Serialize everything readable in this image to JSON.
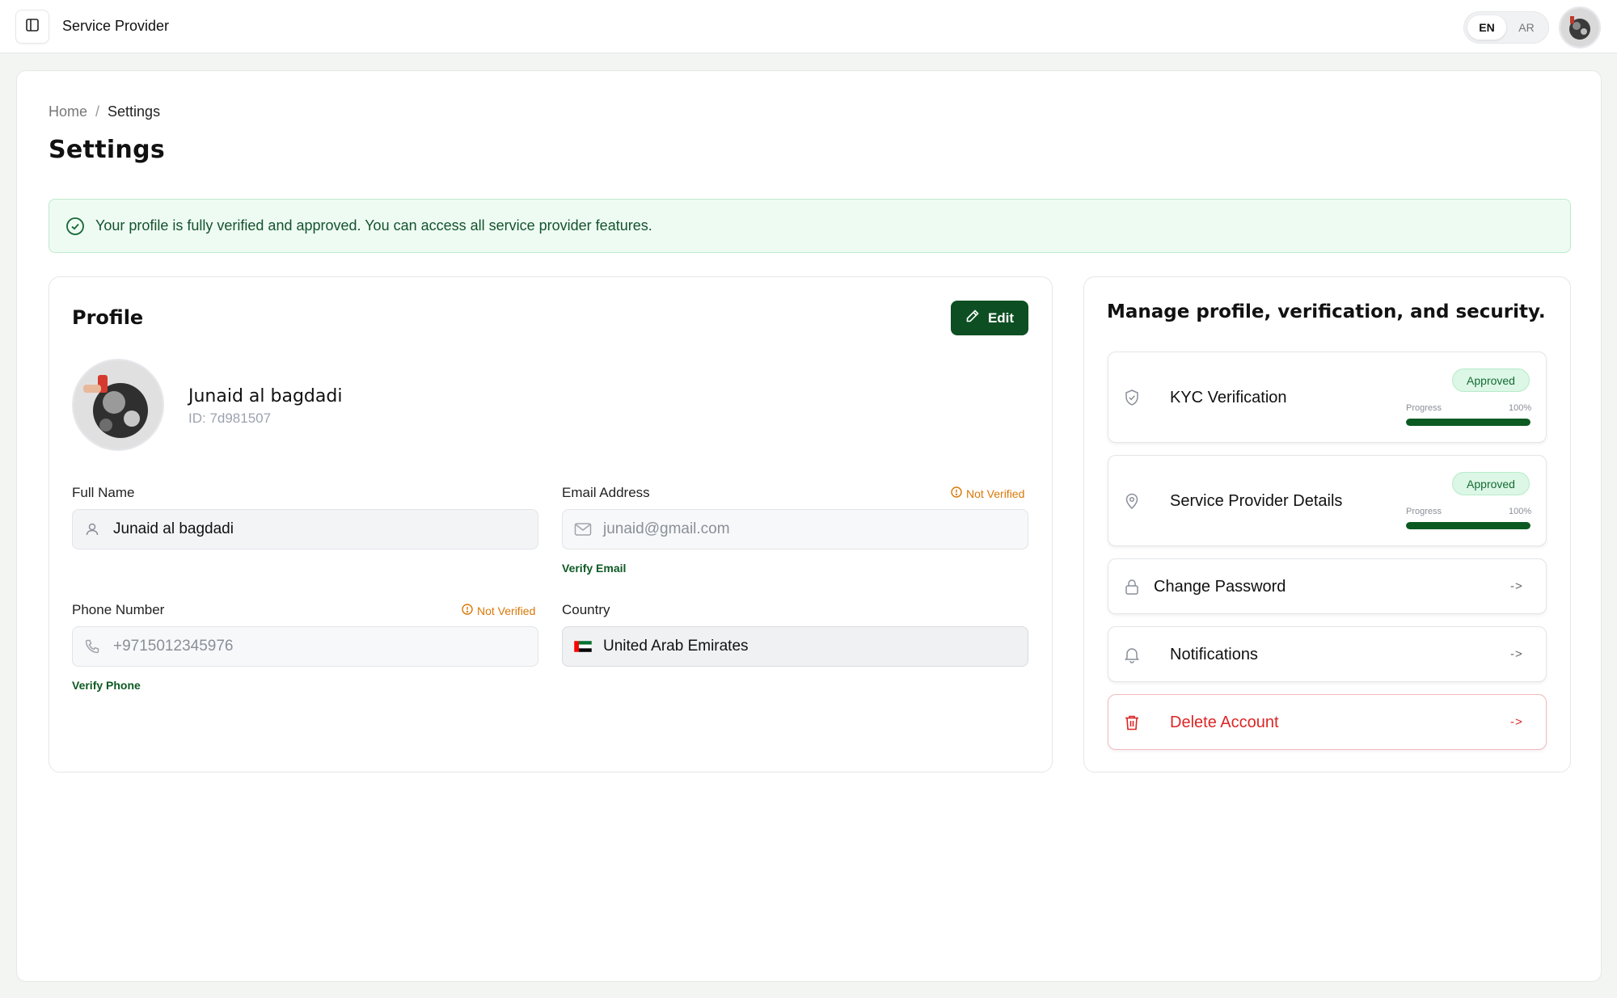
{
  "app": {
    "title": "Service Provider"
  },
  "language": {
    "en": "EN",
    "ar": "AR",
    "selected": "EN"
  },
  "breadcrumb": {
    "home": "Home",
    "separator": "/",
    "current": "Settings"
  },
  "page": {
    "title": "Settings"
  },
  "alert": {
    "message": "Your profile is fully verified and approved. You can access all service provider features."
  },
  "profile": {
    "title": "Profile",
    "edit_label": "Edit",
    "name": "Junaid al bagdadi",
    "id": "ID: 7d981507",
    "fields": {
      "full_name": {
        "label": "Full Name",
        "value": "Junaid al bagdadi"
      },
      "email": {
        "label": "Email Address",
        "value": "junaid@gmail.com",
        "status": "Not Verified",
        "action": "Verify Email"
      },
      "phone": {
        "label": "Phone Number",
        "value": "+9715012345976",
        "status": "Not Verified",
        "action": "Verify Phone"
      },
      "country": {
        "label": "Country",
        "value": "United Arab Emirates"
      }
    }
  },
  "manage": {
    "title": "Manage profile, verification, and security.",
    "items": [
      {
        "label": "KYC Verification",
        "badge": "Approved",
        "progress_label": "Progress",
        "progress_text": "100%",
        "progress": 1.0
      },
      {
        "label": "Service Provider Details",
        "badge": "Approved",
        "progress_label": "Progress",
        "progress_text": "100%",
        "progress": 1.0
      },
      {
        "label": "Change Password",
        "arrow": "->"
      },
      {
        "label": "Notifications",
        "arrow": "->"
      },
      {
        "label": "Delete Account",
        "arrow": "->"
      }
    ]
  },
  "colors": {
    "brand": "#0d4f22",
    "success_bg": "#eefbf3",
    "warning": "#d97706",
    "danger": "#dc2626"
  },
  "icons": [
    "sidebar-icon",
    "check-circle-icon",
    "pencil-icon",
    "user-icon",
    "mail-icon",
    "phone-icon",
    "alert-circle-icon",
    "flag-ae-icon",
    "shield-check-icon",
    "map-pin-icon",
    "lock-icon",
    "bell-icon",
    "trash-icon"
  ]
}
